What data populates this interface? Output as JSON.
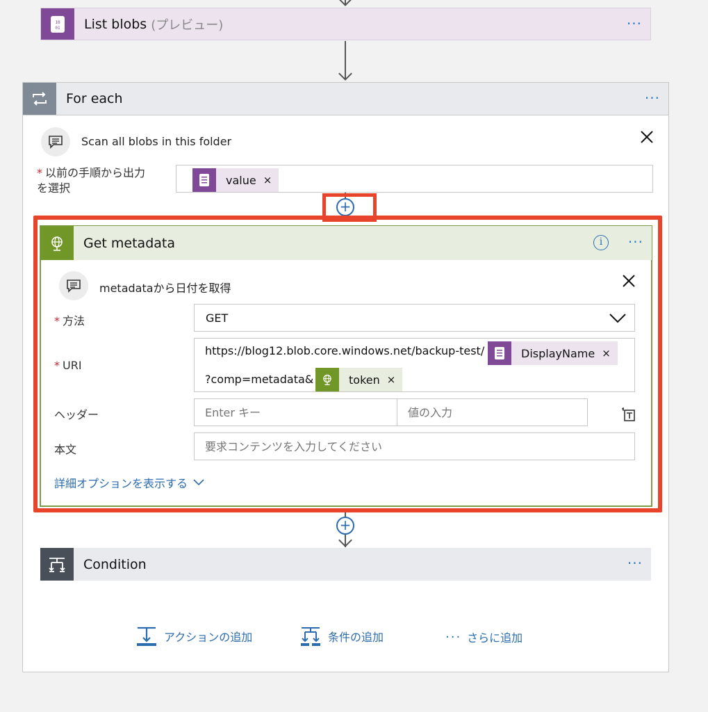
{
  "list_blobs": {
    "title": "List blobs",
    "subtitle": "(プレビュー)",
    "more": "···"
  },
  "for_each": {
    "title": "For each",
    "more": "···",
    "comment": "Scan all blobs in this folder",
    "select_label_line1": "以前の手順から出力",
    "select_label_line2": "を選択",
    "required_mark": "*",
    "token_value": "value",
    "token_close": "×"
  },
  "get_metadata": {
    "title": "Get metadata",
    "info": "i",
    "more": "···",
    "comment": "metadataから日付を取得",
    "method_label": "方法",
    "method_value": "GET",
    "uri_label": "URI",
    "uri_text1": "https://blog12.blob.core.windows.net/backup-test/",
    "uri_token1": "DisplayName",
    "uri_text2": "?comp=metadata&",
    "uri_token2": "token",
    "token_close": "×",
    "headers_label": "ヘッダー",
    "header_key_placeholder": "Enter キー",
    "header_value_placeholder": "値の入力",
    "body_label": "本文",
    "body_placeholder": "要求コンテンツを入力してください",
    "advanced_options": "詳細オプションを表示する"
  },
  "condition": {
    "title": "Condition",
    "more": "···"
  },
  "footer": {
    "add_action": "アクションの追加",
    "add_condition": "条件の追加",
    "more_dots": "···",
    "add_more": "さらに追加"
  },
  "colors": {
    "blob_purple": "#804998",
    "foreach_gray": "#7f8a96",
    "http_green": "#709727",
    "condition_dark": "#484f58",
    "highlight_red": "#e8432b",
    "link_blue": "#2b6cb0"
  }
}
